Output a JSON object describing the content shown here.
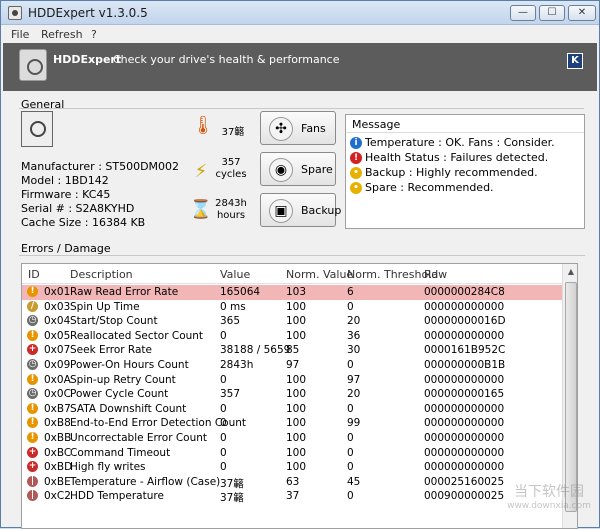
{
  "window": {
    "title": "HDDExpert v1.3.0.5",
    "btn_min": "—",
    "btn_max": "☐",
    "btn_close": "✕"
  },
  "menu": [
    {
      "label": "File"
    },
    {
      "label": "Refresh"
    },
    {
      "label": "?"
    }
  ],
  "banner": {
    "name": "HDDExpert",
    "tagline": "Check your drive's health & performance",
    "help_glyph": "K"
  },
  "general": {
    "label": "General",
    "manufacturer": "Manufacturer : ST500DM002",
    "model": "Model : 1BD142",
    "firmware": "Firmware : KC45",
    "serial": "Serial # : S2A8KYHD",
    "cache": "Cache Size : 16384 KB",
    "temperature": "37簵",
    "cycles_value": "357",
    "cycles_unit": "cycles",
    "hours_value": "2843h",
    "hours_unit": "hours"
  },
  "buttons": {
    "fans": "Fans",
    "spare": "Spare",
    "backup": "Backup"
  },
  "message": {
    "header": "Message",
    "rows": [
      {
        "icon": "info-icon",
        "color": "#1f6fd0",
        "glyph": "i",
        "text": "Temperature : OK. Fans : Consider."
      },
      {
        "icon": "error-icon",
        "color": "#d42020",
        "glyph": "!",
        "text": "Health Status : Failures detected."
      },
      {
        "icon": "bulb-icon",
        "color": "#e8b000",
        "glyph": "•",
        "text": "Backup : Highly recommended."
      },
      {
        "icon": "bulb-icon",
        "color": "#e8b000",
        "glyph": "•",
        "text": "Spare : Recommended."
      }
    ]
  },
  "errors": {
    "label": "Errors / Damage",
    "columns": [
      "ID",
      "Description",
      "Value",
      "Norm. Value",
      "Norm. Threshold",
      "Raw"
    ],
    "rows": [
      {
        "icon": "warning-icon",
        "color": "#e69500",
        "id": "0x01",
        "desc": "Raw Read Error Rate",
        "value": "165064",
        "norm": "103",
        "thr": "6",
        "raw": "0000000284C8",
        "hl": true
      },
      {
        "icon": "pencil-icon",
        "color": "#c99a2e",
        "id": "0x03",
        "desc": "Spin Up Time",
        "value": "0 ms",
        "norm": "100",
        "thr": "0",
        "raw": "000000000000"
      },
      {
        "icon": "clock-icon",
        "color": "#6b6b6b",
        "id": "0x04",
        "desc": "Start/Stop Count",
        "value": "365",
        "norm": "100",
        "thr": "20",
        "raw": "00000000016D"
      },
      {
        "icon": "warning-icon",
        "color": "#e69500",
        "id": "0x05",
        "desc": "Reallocated Sector Count",
        "value": "0",
        "norm": "100",
        "thr": "36",
        "raw": "000000000000"
      },
      {
        "icon": "medical-icon",
        "color": "#c92a2a",
        "id": "0x07",
        "desc": "Seek Error Rate",
        "value": "38188 / 5659",
        "norm": "85",
        "thr": "30",
        "raw": "0000161B952C"
      },
      {
        "icon": "clock-icon",
        "color": "#6b6b6b",
        "id": "0x09",
        "desc": "Power-On Hours Count",
        "value": "2843h",
        "norm": "97",
        "thr": "0",
        "raw": "000000000B1B"
      },
      {
        "icon": "warning-icon",
        "color": "#e69500",
        "id": "0x0A",
        "desc": "Spin-up Retry Count",
        "value": "0",
        "norm": "100",
        "thr": "97",
        "raw": "000000000000"
      },
      {
        "icon": "clock-icon",
        "color": "#6b6b6b",
        "id": "0x0C",
        "desc": "Power Cycle Count",
        "value": "357",
        "norm": "100",
        "thr": "20",
        "raw": "000000000165"
      },
      {
        "icon": "warning-icon",
        "color": "#e69500",
        "id": "0xB7",
        "desc": "SATA Downshift Count",
        "value": "0",
        "norm": "100",
        "thr": "0",
        "raw": "000000000000"
      },
      {
        "icon": "warning-icon",
        "color": "#e69500",
        "id": "0xB8",
        "desc": "End-to-End Error Detection Count",
        "value": "0",
        "norm": "100",
        "thr": "99",
        "raw": "000000000000"
      },
      {
        "icon": "warning-icon",
        "color": "#e69500",
        "id": "0xBB",
        "desc": "Uncorrectable Error Count",
        "value": "0",
        "norm": "100",
        "thr": "0",
        "raw": "000000000000"
      },
      {
        "icon": "medical-icon",
        "color": "#c92a2a",
        "id": "0xBC",
        "desc": "Command Timeout",
        "value": "0",
        "norm": "100",
        "thr": "0",
        "raw": "000000000000"
      },
      {
        "icon": "medical-icon",
        "color": "#c92a2a",
        "id": "0xBD",
        "desc": "High fly writes",
        "value": "0",
        "norm": "100",
        "thr": "0",
        "raw": "000000000000"
      },
      {
        "icon": "thermometer-icon",
        "color": "#b05a5a",
        "id": "0xBE",
        "desc": "Temperature - Airflow (Case)",
        "value": "37簵",
        "norm": "63",
        "thr": "45",
        "raw": "000025160025"
      },
      {
        "icon": "thermometer-icon",
        "color": "#b05a5a",
        "id": "0xC2",
        "desc": "HDD Temperature",
        "value": "37簵",
        "norm": "37",
        "thr": "0",
        "raw": "000900000025"
      }
    ]
  },
  "watermark": {
    "text": "当下软件园",
    "url": "www.downxia.com"
  }
}
